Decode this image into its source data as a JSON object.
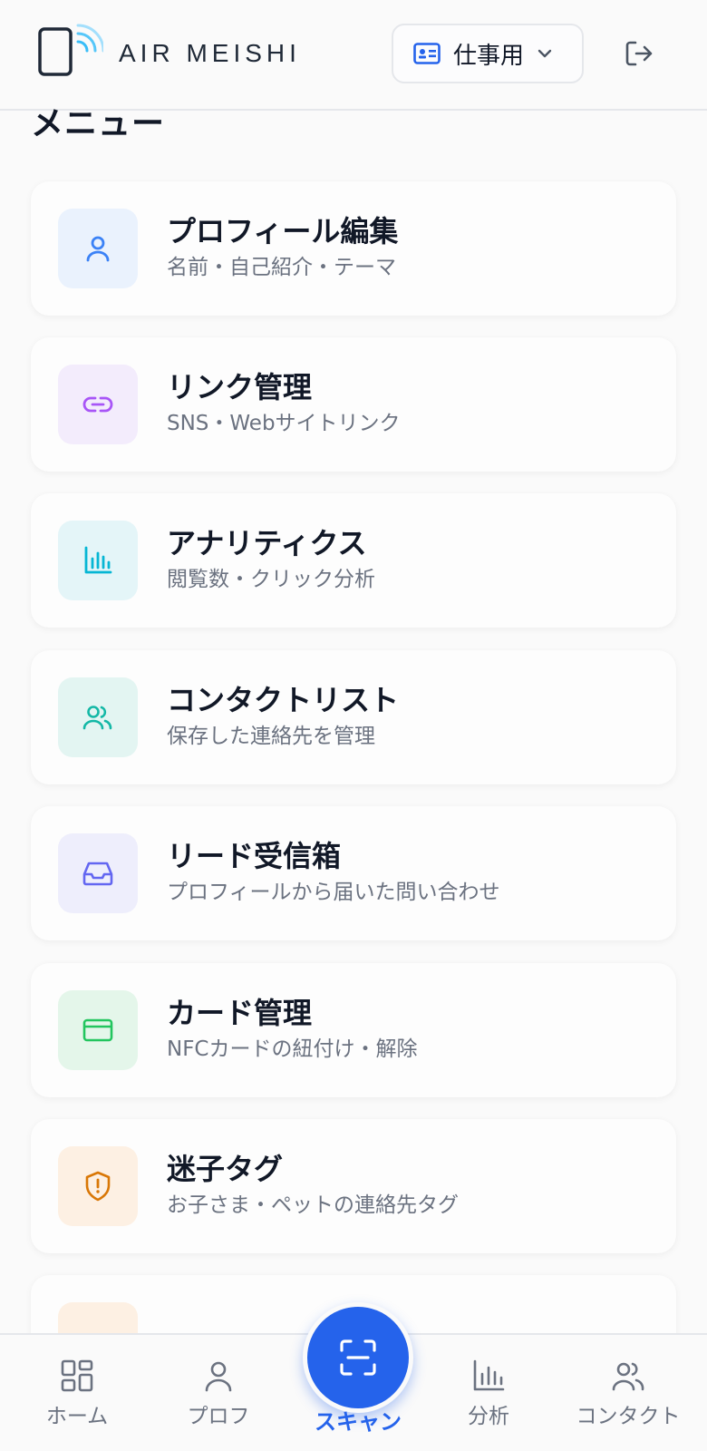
{
  "header": {
    "brand": "AIR MEISHI",
    "profile_selector": "仕事用"
  },
  "menu_title": "メニュー",
  "menu": {
    "items": [
      {
        "title": "プロフィール編集",
        "subtitle": "名前・自己紹介・テーマ",
        "icon": "user-icon",
        "icon_color": "#3b82f6",
        "icon_bg": "#eaf2fd"
      },
      {
        "title": "リンク管理",
        "subtitle": "SNS・Webサイトリンク",
        "icon": "link-icon",
        "icon_color": "#a855f7",
        "icon_bg": "#f3ecfc"
      },
      {
        "title": "アナリティクス",
        "subtitle": "閲覧数・クリック分析",
        "icon": "bar-chart-icon",
        "icon_color": "#06b6d4",
        "icon_bg": "#e4f5f8"
      },
      {
        "title": "コンタクトリスト",
        "subtitle": "保存した連絡先を管理",
        "icon": "users-icon",
        "icon_color": "#14b8a6",
        "icon_bg": "#e3f5f2"
      },
      {
        "title": "リード受信箱",
        "subtitle": "プロフィールから届いた問い合わせ",
        "icon": "inbox-icon",
        "icon_color": "#6366f1",
        "icon_bg": "#eeeefc"
      },
      {
        "title": "カード管理",
        "subtitle": "NFCカードの紐付け・解除",
        "icon": "credit-card-icon",
        "icon_color": "#22c55e",
        "icon_bg": "#e4f6ea"
      },
      {
        "title": "迷子タグ",
        "subtitle": "お子さま・ペットの連絡先タグ",
        "icon": "shield-alert-icon",
        "icon_color": "#d97706",
        "icon_bg": "#fdf0e3"
      }
    ]
  },
  "nav": {
    "home": "ホーム",
    "profile": "プロフ",
    "scan": "スキャン",
    "analytics": "分析",
    "contacts": "コンタクト"
  },
  "colors": {
    "accent": "#2563eb",
    "muted_text": "#6b7280"
  }
}
